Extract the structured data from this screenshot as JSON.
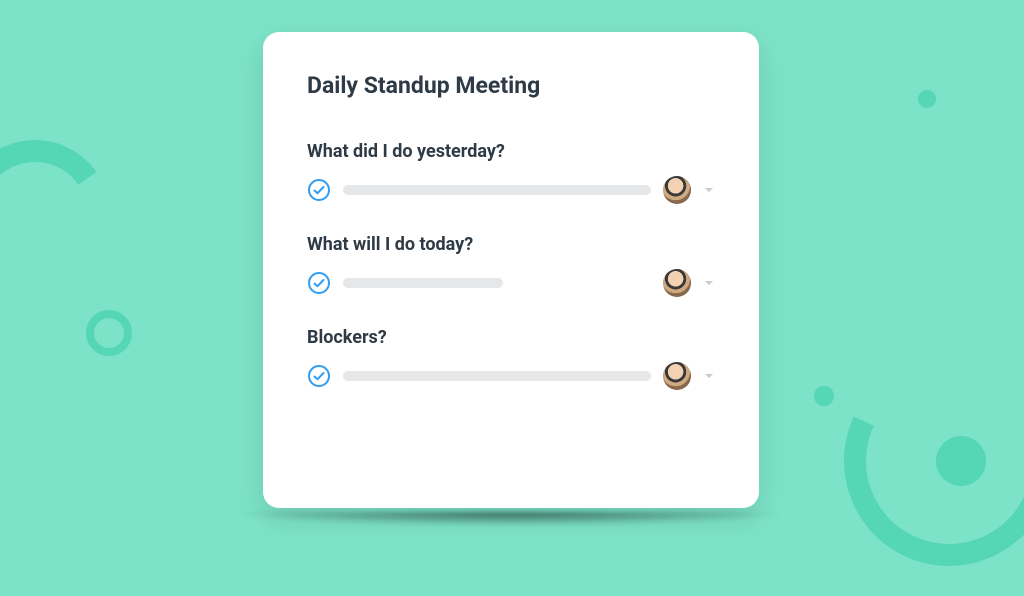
{
  "card": {
    "title": "Daily Standup Meeting",
    "sections": [
      {
        "label": "What did I do yesterday?",
        "variant": "long"
      },
      {
        "label": "What will I do today?",
        "variant": "short"
      },
      {
        "label": "Blockers?",
        "variant": "long"
      }
    ]
  },
  "colors": {
    "accent": "#2f9df4",
    "background": "#7de3c8",
    "text": "#2e3a45"
  }
}
